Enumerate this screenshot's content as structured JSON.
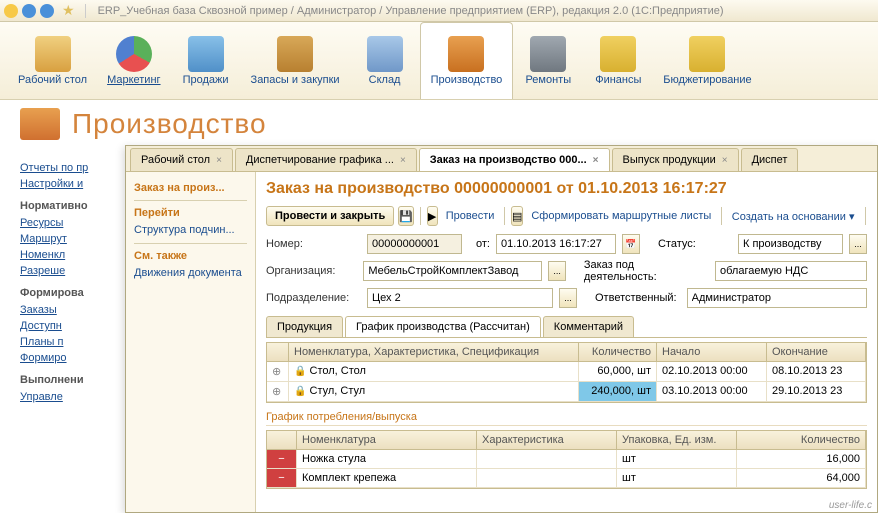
{
  "titlebar": "ERP_Учебная база Сквозной пример / Администратор / Управление предприятием (ERP), редакция 2.0  (1С:Предприятие)",
  "toolbar": [
    {
      "label": "Рабочий\nстол"
    },
    {
      "label": "Маркетинг",
      "underline": true
    },
    {
      "label": "Продажи"
    },
    {
      "label": "Запасы и\nзакупки"
    },
    {
      "label": "Склад"
    },
    {
      "label": "Производство",
      "active": true
    },
    {
      "label": "Ремонты"
    },
    {
      "label": "Финансы"
    },
    {
      "label": "Бюджетирование"
    }
  ],
  "section_title": "Производство",
  "left_links": {
    "top": [
      "Отчеты по пр",
      "Настройки и"
    ],
    "g1": "Нормативно",
    "g1_items": [
      "Ресурсы",
      "Маршрут",
      "Номенкл",
      "Разреше"
    ],
    "g2": "Формирова",
    "g2_items": [
      "Заказы",
      "Доступн",
      "Планы п",
      "Формиро"
    ],
    "g3": "Выполнени",
    "g3_items": [
      "Управле"
    ]
  },
  "tabs": [
    {
      "label": "Рабочий стол"
    },
    {
      "label": "Диспетчирование графика ..."
    },
    {
      "label": "Заказ на производство 000...",
      "active": true
    },
    {
      "label": "Выпуск продукции"
    },
    {
      "label": "Диспет"
    }
  ],
  "nav": {
    "hdr": "Заказ на произ...",
    "perejti": "Перейти",
    "struct": "Структура подчин...",
    "sm": "См. также",
    "dvij": "Движения документа"
  },
  "form": {
    "title": "Заказ на производство 00000000001 от 01.10.2013 16:17:27",
    "btns": {
      "post_close": "Провести и закрыть",
      "post": "Провести",
      "routes": "Сформировать маршрутные листы",
      "create": "Создать на основании"
    },
    "labels": {
      "num": "Номер:",
      "from": "от:",
      "status": "Статус:",
      "org": "Организация:",
      "zakaz": "Заказ под деятельность:",
      "podr": "Подразделение:",
      "otv": "Ответственный:"
    },
    "vals": {
      "num": "00000000001",
      "from": "01.10.2013 16:17:27",
      "status": "К производству",
      "org": "МебельСтройКомплектЗавод",
      "zakaz": "облагаемую НДС",
      "podr": "Цех 2",
      "otv": "Администратор"
    }
  },
  "sub_tabs": [
    "Продукция",
    "График производства (Рассчитан)",
    "Комментарий"
  ],
  "grid1": {
    "cols": [
      "",
      "Номенклатура, Характеристика, Спецификация",
      "Количество",
      "Начало",
      "Окончание"
    ],
    "rows": [
      {
        "name": "Стол, Стол",
        "qty": "60,000, шт",
        "start": "02.10.2013 00:00",
        "end": "08.10.2013 23"
      },
      {
        "name": "Стул, Стул",
        "qty": "240,000, шт",
        "start": "03.10.2013 00:00",
        "end": "29.10.2013 23",
        "sel": true
      }
    ]
  },
  "fieldset": "График потребления/выпуска",
  "grid2": {
    "cols": [
      "",
      "Номенклатура",
      "Характеристика",
      "Упаковка, Ед. изм.",
      "Количество"
    ],
    "rows": [
      {
        "mark": "−",
        "name": "Ножка стула",
        "pack": "шт",
        "qty": "16,000"
      },
      {
        "mark": "−",
        "name": "Комплект крепежа",
        "pack": "шт",
        "qty": "64,000"
      }
    ]
  },
  "watermark": "user-life.c"
}
